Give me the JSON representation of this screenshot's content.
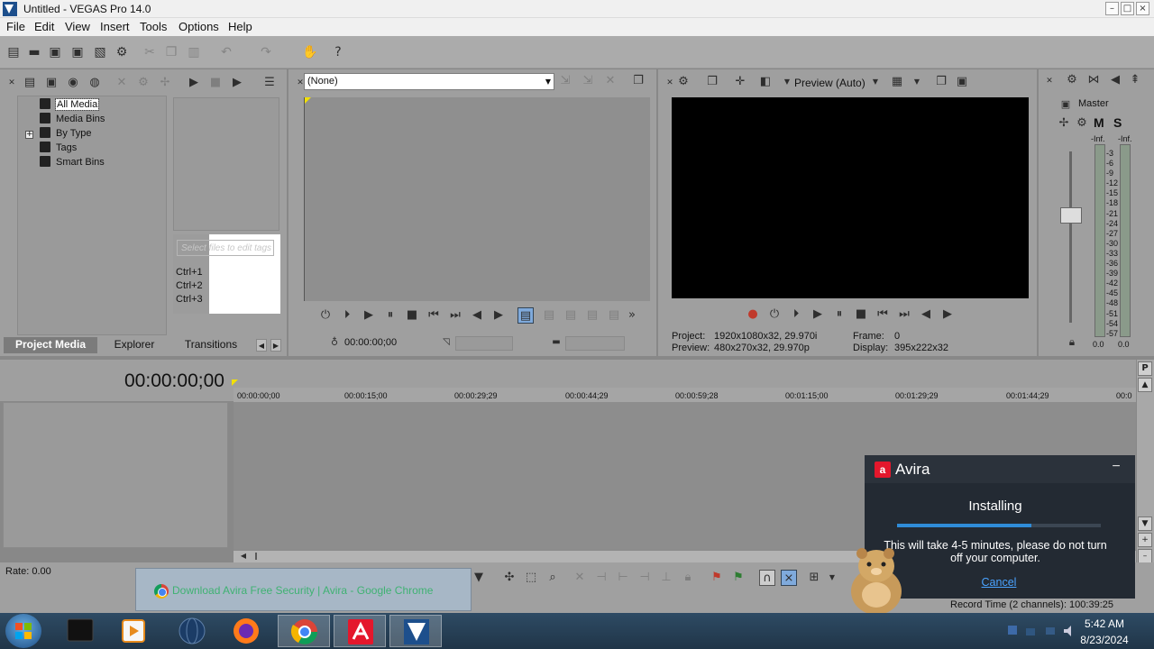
{
  "window": {
    "title": "Untitled - VEGAS Pro 14.0"
  },
  "menu": [
    "File",
    "Edit",
    "View",
    "Insert",
    "Tools",
    "Options",
    "Help"
  ],
  "project_media": {
    "tree": [
      "All Media",
      "Media Bins",
      "By Type",
      "Tags",
      "Smart Bins"
    ],
    "tag_placeholder": "Select files to edit tags",
    "shortcuts": [
      "Ctrl+1",
      "Ctrl+2",
      "Ctrl+3"
    ],
    "tabs": [
      "Project Media",
      "Explorer",
      "Transitions"
    ]
  },
  "trimmer": {
    "selection": "(None)",
    "timecode": "00:00:00;00"
  },
  "preview": {
    "quality": "Preview (Auto)",
    "project_label": "Project:",
    "project_value": "1920x1080x32, 29.970i",
    "preview_label": "Preview:",
    "preview_value": "480x270x32, 29.970p",
    "frame_label": "Frame:",
    "frame_value": "0",
    "display_label": "Display:",
    "display_value": "395x222x32"
  },
  "master": {
    "label": "Master",
    "mute": "M",
    "solo": "S",
    "inf_left": "-Inf.",
    "inf_right": "-Inf.",
    "scale": [
      "3",
      "6",
      "9",
      "12",
      "15",
      "18",
      "21",
      "24",
      "27",
      "30",
      "33",
      "36",
      "39",
      "42",
      "45",
      "48",
      "51",
      "54",
      "57"
    ],
    "level_left": "0.0",
    "level_right": "0.0"
  },
  "timeline": {
    "timecode": "00:00:00;00",
    "ruler": [
      "00:00:00;00",
      "00:00:15;00",
      "00:00:29;29",
      "00:00:44;29",
      "00:00:59;28",
      "00:01:15;00",
      "00:01:29;29",
      "00:01:44;29",
      "00:0"
    ],
    "rate": "Rate: 0.00",
    "record_time": "Record Time (2 channels): 100:39:25"
  },
  "notification": {
    "text": "Download Avira Free Security | Avira - Google Chrome"
  },
  "avira": {
    "title": "Avira",
    "status": "Installing",
    "progress": 0.66,
    "message": "This will take 4-5 minutes, please do not turn off your computer.",
    "cancel": "Cancel",
    "accent": "#e4172c",
    "bar_color": "#2f8cd8"
  },
  "taskbar": {
    "time": "5:42 AM",
    "date": "8/23/2024"
  }
}
